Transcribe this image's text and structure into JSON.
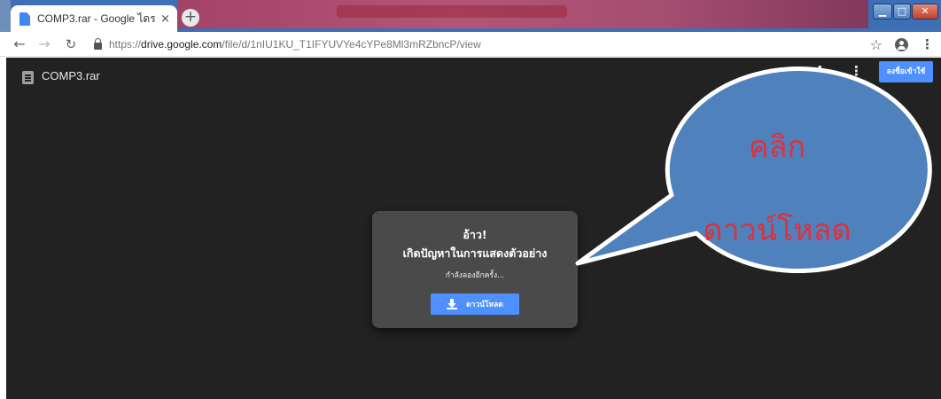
{
  "browser": {
    "tab_title": "COMP3.rar - Google ไดรฟ์",
    "tab_close": "×",
    "new_tab": "+",
    "url_prefix": "https://",
    "url_host": "drive.google.com",
    "url_path": "/file/d/1nIU1KU_T1IFYUVYe4cYPe8Ml3mRZbncP/view",
    "icons": [
      "back-arrow-icon",
      "forward-arrow-icon",
      "reload-icon",
      "lock-icon",
      "star-icon",
      "profile-icon",
      "menu-kebab-icon"
    ]
  },
  "viewer": {
    "file_name": "COMP3.rar",
    "signin_label": "ลงชื่อเข้าใช้",
    "icons": [
      "file-icon",
      "download-icon",
      "more-vert-icon"
    ]
  },
  "error_card": {
    "title": "อ้าว!",
    "message": "เกิดปัญหาในการแสดงตัวอย่าง",
    "retry_text": "กำลังลองอีกครั้ง...",
    "download_label": "ดาวน์โหลด"
  },
  "callout": {
    "line1": "คลิก",
    "line2": "ดาวน์โหลด",
    "fill_color": "#4f81bd",
    "text_color": "#e0303a"
  }
}
